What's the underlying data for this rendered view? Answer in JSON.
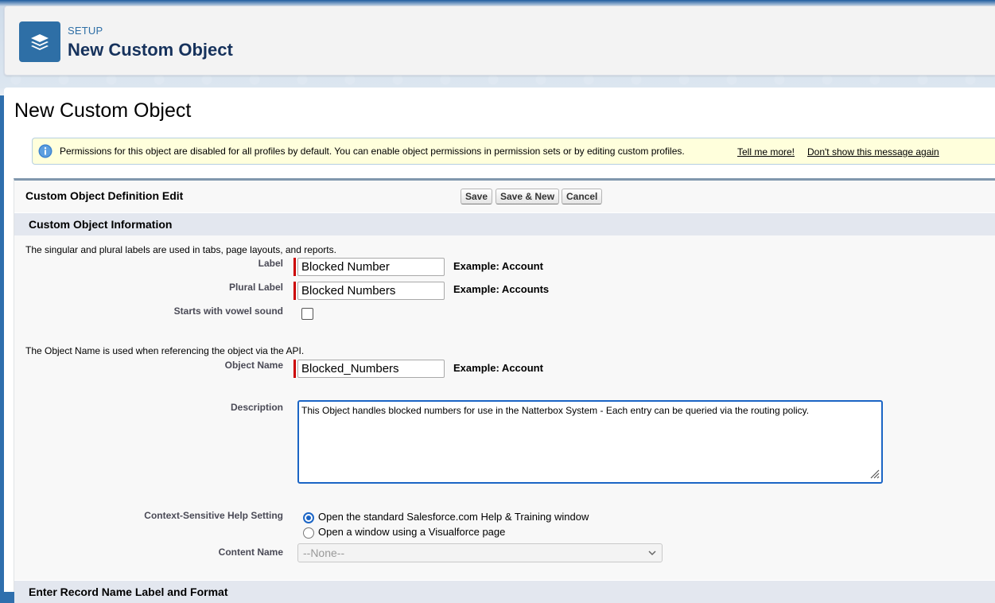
{
  "setup_header": {
    "kicker": "SETUP",
    "title": "New Custom Object",
    "icon": "layers-icon"
  },
  "page": {
    "title": "New Custom Object"
  },
  "info_bar": {
    "icon": "info-icon",
    "text": "Permissions for this object are disabled for all profiles by default. You can enable object permissions in permission sets or by editing custom profiles.",
    "tell_me_more": "Tell me more!",
    "dont_show": "Don't show this message again"
  },
  "panel": {
    "title": "Custom Object Definition Edit",
    "buttons": {
      "save": "Save",
      "save_new": "Save & New",
      "cancel": "Cancel"
    }
  },
  "section_info": {
    "title": "Custom Object Information",
    "labels_note": "The singular and plural labels are used in tabs, page layouts, and reports.",
    "api_note": "The Object Name is used when referencing the object via the API."
  },
  "fields": {
    "label": {
      "label": "Label",
      "value": "Blocked Number",
      "example": "Example:  Account"
    },
    "plural_label": {
      "label": "Plural Label",
      "value": "Blocked Numbers",
      "example": "Example:  Accounts"
    },
    "vowel": {
      "label": "Starts with vowel sound",
      "checked": false
    },
    "object_name": {
      "label": "Object Name",
      "value": "Blocked_Numbers",
      "example": "Example:  Account"
    },
    "description": {
      "label": "Description",
      "value": "This Object handles blocked numbers for use in the Natterbox System - Each entry can be queried via the routing policy."
    },
    "help_setting": {
      "label": "Context-Sensitive Help Setting",
      "options": [
        "Open the standard Salesforce.com Help & Training window",
        "Open a window using a Visualforce page"
      ],
      "selected": 0
    },
    "content_name": {
      "label": "Content Name",
      "value": "--None--"
    }
  },
  "section_record": {
    "title": "Enter Record Name Label and Format"
  },
  "colors": {
    "brand_blue": "#2e6fa6",
    "focus_blue": "#1b65c5",
    "required_red": "#cc0000",
    "info_bg": "#ffffdc"
  }
}
